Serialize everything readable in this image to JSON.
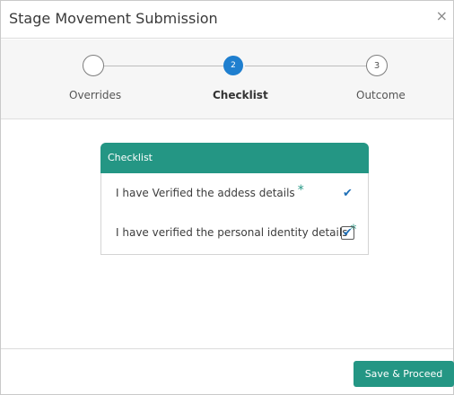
{
  "dialog": {
    "title": "Stage Movement Submission",
    "close_glyph": "×"
  },
  "stepper": {
    "steps": [
      {
        "number": "",
        "label": "Overrides",
        "state": "completed"
      },
      {
        "number": "2",
        "label": "Checklist",
        "state": "active"
      },
      {
        "number": "3",
        "label": "Outcome",
        "state": "pending"
      }
    ]
  },
  "checklist": {
    "header": "Checklist",
    "items": [
      {
        "label": "I have Verified the addess details",
        "required_marker": "*",
        "checked": true,
        "check_glyph": "✔"
      },
      {
        "label": "I have verified the personal identity details",
        "required_marker": "*",
        "checked": true,
        "check_glyph": "✔"
      }
    ]
  },
  "footer": {
    "save_label": "Save & Proceed"
  },
  "colors": {
    "accent_teal": "#249684",
    "active_step_blue": "#1f7fcf",
    "check_blue": "#1f6fb7"
  }
}
